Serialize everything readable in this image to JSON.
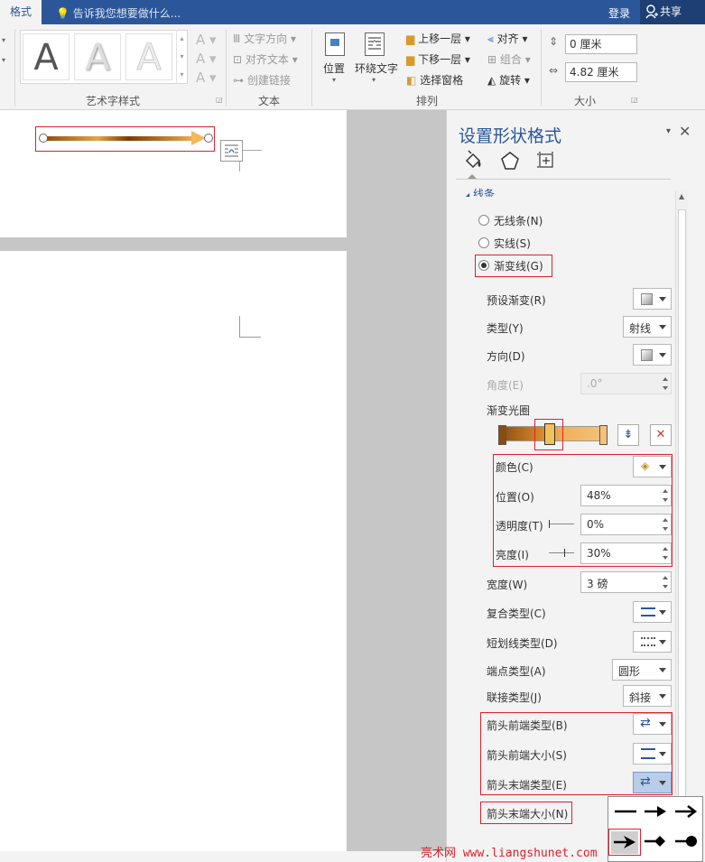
{
  "topbar": {
    "tab": "格式",
    "tell_me": "告诉我您想要做什么...",
    "login": "登录",
    "share": "共享"
  },
  "ribbon": {
    "wordart_group": "艺术字样式",
    "wordart_letter": "A",
    "text_group": "文本",
    "text_direction": "文字方向",
    "align_text": "对齐文本",
    "create_link": "创建链接",
    "arrange_group": "排列",
    "position": "位置",
    "wrap_text": "环绕文字",
    "bring_forward": "上移一层",
    "send_backward": "下移一层",
    "selection_pane": "选择窗格",
    "align": "对齐",
    "group": "组合",
    "rotate": "旋转",
    "size_group": "大小",
    "height": "0 厘米",
    "width": "4.82 厘米"
  },
  "pane": {
    "title": "设置形状格式",
    "section": "线条",
    "no_line": "无线条(N)",
    "solid_line": "实线(S)",
    "gradient_line": "渐变线(G)",
    "preset_gradient": "预设渐变(R)",
    "type": "类型(Y)",
    "type_value": "射线",
    "direction": "方向(D)",
    "angle": "角度(E)",
    "angle_value": ".0°",
    "gradient_stops": "渐变光圈",
    "color": "颜色(C)",
    "position": "位置(O)",
    "position_value": "48%",
    "transparency": "透明度(T)",
    "transparency_value": "0%",
    "brightness": "亮度(I)",
    "brightness_value": "30%",
    "width": "宽度(W)",
    "width_value": "3 磅",
    "compound_type": "复合类型(C)",
    "dash_type": "短划线类型(D)",
    "cap_type": "端点类型(A)",
    "cap_value": "圆形",
    "join_type": "联接类型(J)",
    "join_value": "斜接",
    "begin_arrow_type": "箭头前端类型(B)",
    "begin_arrow_size": "箭头前端大小(S)",
    "end_arrow_type": "箭头末端类型(E)",
    "end_arrow_size": "箭头末端大小(N)"
  },
  "watermark": "亮术网 www.liangshunet.com",
  "colors": {
    "accent": "#2b579a",
    "highlight": "#e0202a"
  }
}
